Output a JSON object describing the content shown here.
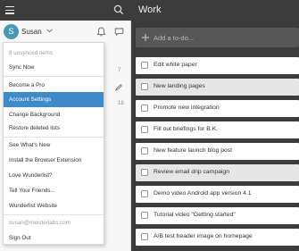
{
  "sidebar": {
    "username": "Susan",
    "avatar_letter": "S",
    "counts": [
      "7",
      "18"
    ]
  },
  "menu": {
    "items": [
      {
        "label": "8 unsynced items",
        "muted": true,
        "active": false
      },
      {
        "label": "Sync Now",
        "muted": false,
        "active": false
      },
      {
        "label": "Become a Pro",
        "muted": false,
        "active": false
      },
      {
        "label": "Account Settings",
        "muted": false,
        "active": true
      },
      {
        "label": "Change Background",
        "muted": false,
        "active": false
      },
      {
        "label": "Restore deleted lists",
        "muted": false,
        "active": false
      },
      {
        "label": "See What's New",
        "muted": false,
        "active": false
      },
      {
        "label": "Install the Browser Extension",
        "muted": false,
        "active": false
      },
      {
        "label": "Love Wunderlist?",
        "muted": false,
        "active": false
      },
      {
        "label": "Tell Your Friends...",
        "muted": false,
        "active": false
      },
      {
        "label": "Wunderlist Website",
        "muted": false,
        "active": false
      },
      {
        "label": "susan@meisterlabs.com",
        "muted": true,
        "active": false
      },
      {
        "label": "Sign Out",
        "muted": false,
        "active": false
      }
    ]
  },
  "main": {
    "title": "Work",
    "add_placeholder": "Add a to-do...",
    "tasks": [
      {
        "title": "Edit white paper",
        "selected": false
      },
      {
        "title": "New landing pages",
        "selected": true
      },
      {
        "title": "Promote new integration",
        "selected": false
      },
      {
        "title": "Fill out briefings for B.K.",
        "selected": false
      },
      {
        "title": "New feature launch blog post",
        "selected": false
      },
      {
        "title": "Review email drip campaign",
        "selected": true
      },
      {
        "title": "Demo video Android app version 4.1",
        "selected": false
      },
      {
        "title": "Tutorial video \"Getting started\"",
        "selected": false
      },
      {
        "title": "A/B test header image on homepage",
        "selected": false
      }
    ]
  },
  "colors": {
    "accent": "#3f8ac9",
    "avatar": "#4a99b3",
    "dark_bg": "#3c3c3c"
  },
  "icons": [
    "hamburger-icon",
    "search-icon",
    "chevron-down-icon",
    "bell-icon",
    "chat-icon",
    "pen-icon",
    "plus-icon"
  ]
}
